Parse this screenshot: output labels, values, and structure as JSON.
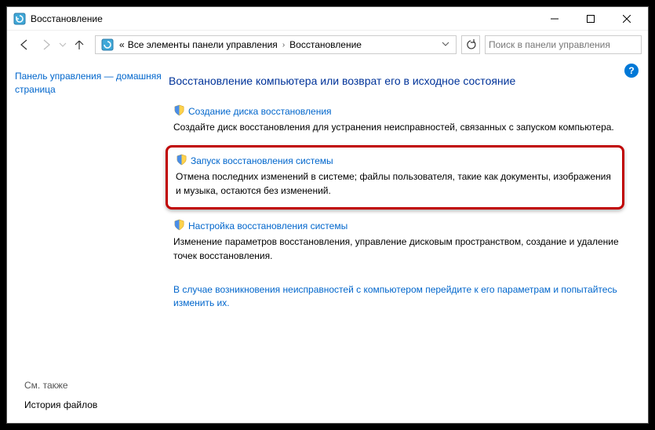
{
  "window": {
    "title": "Восстановление"
  },
  "nav": {
    "crumb1": "Все элементы панели управления",
    "crumb2": "Восстановление",
    "search_placeholder": "Поиск в панели управления"
  },
  "sidebar": {
    "home_link": "Панель управления — домашняя страница",
    "see_also_label": "См. также",
    "file_history_link": "История файлов"
  },
  "main": {
    "heading": "Восстановление компьютера или возврат его в исходное состояние",
    "items": [
      {
        "link": "Создание диска восстановления",
        "desc": "Создайте диск восстановления для устранения неисправностей, связанных с запуском компьютера."
      },
      {
        "link": "Запуск восстановления системы",
        "desc": "Отмена последних изменений в системе; файлы пользователя, такие как документы, изображения и музыка, остаются без изменений."
      },
      {
        "link": "Настройка восстановления системы",
        "desc": "Изменение параметров восстановления, управление дисковым пространством, создание и удаление точек восстановления."
      }
    ],
    "trouble_link": "В случае возникновения неисправностей с компьютером перейдите к его параметрам и попытайтесь изменить их."
  }
}
